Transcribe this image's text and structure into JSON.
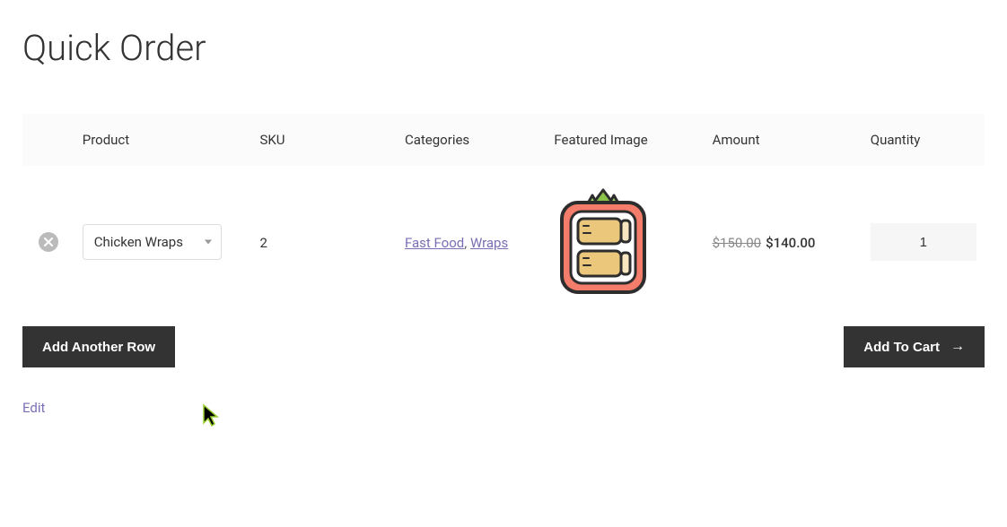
{
  "page": {
    "title": "Quick Order"
  },
  "table": {
    "headers": {
      "product": "Product",
      "sku": "SKU",
      "categories": "Categories",
      "image": "Featured Image",
      "amount": "Amount",
      "quantity": "Quantity"
    },
    "rows": [
      {
        "product_name": "Chicken Wraps",
        "sku": "2",
        "category1": "Fast Food",
        "category2": "Wraps",
        "original_price": "$150.00",
        "sale_price": "$140.00",
        "quantity": "1"
      }
    ]
  },
  "buttons": {
    "add_row": "Add Another Row",
    "add_to_cart": "Add To Cart"
  },
  "links": {
    "edit": "Edit"
  }
}
